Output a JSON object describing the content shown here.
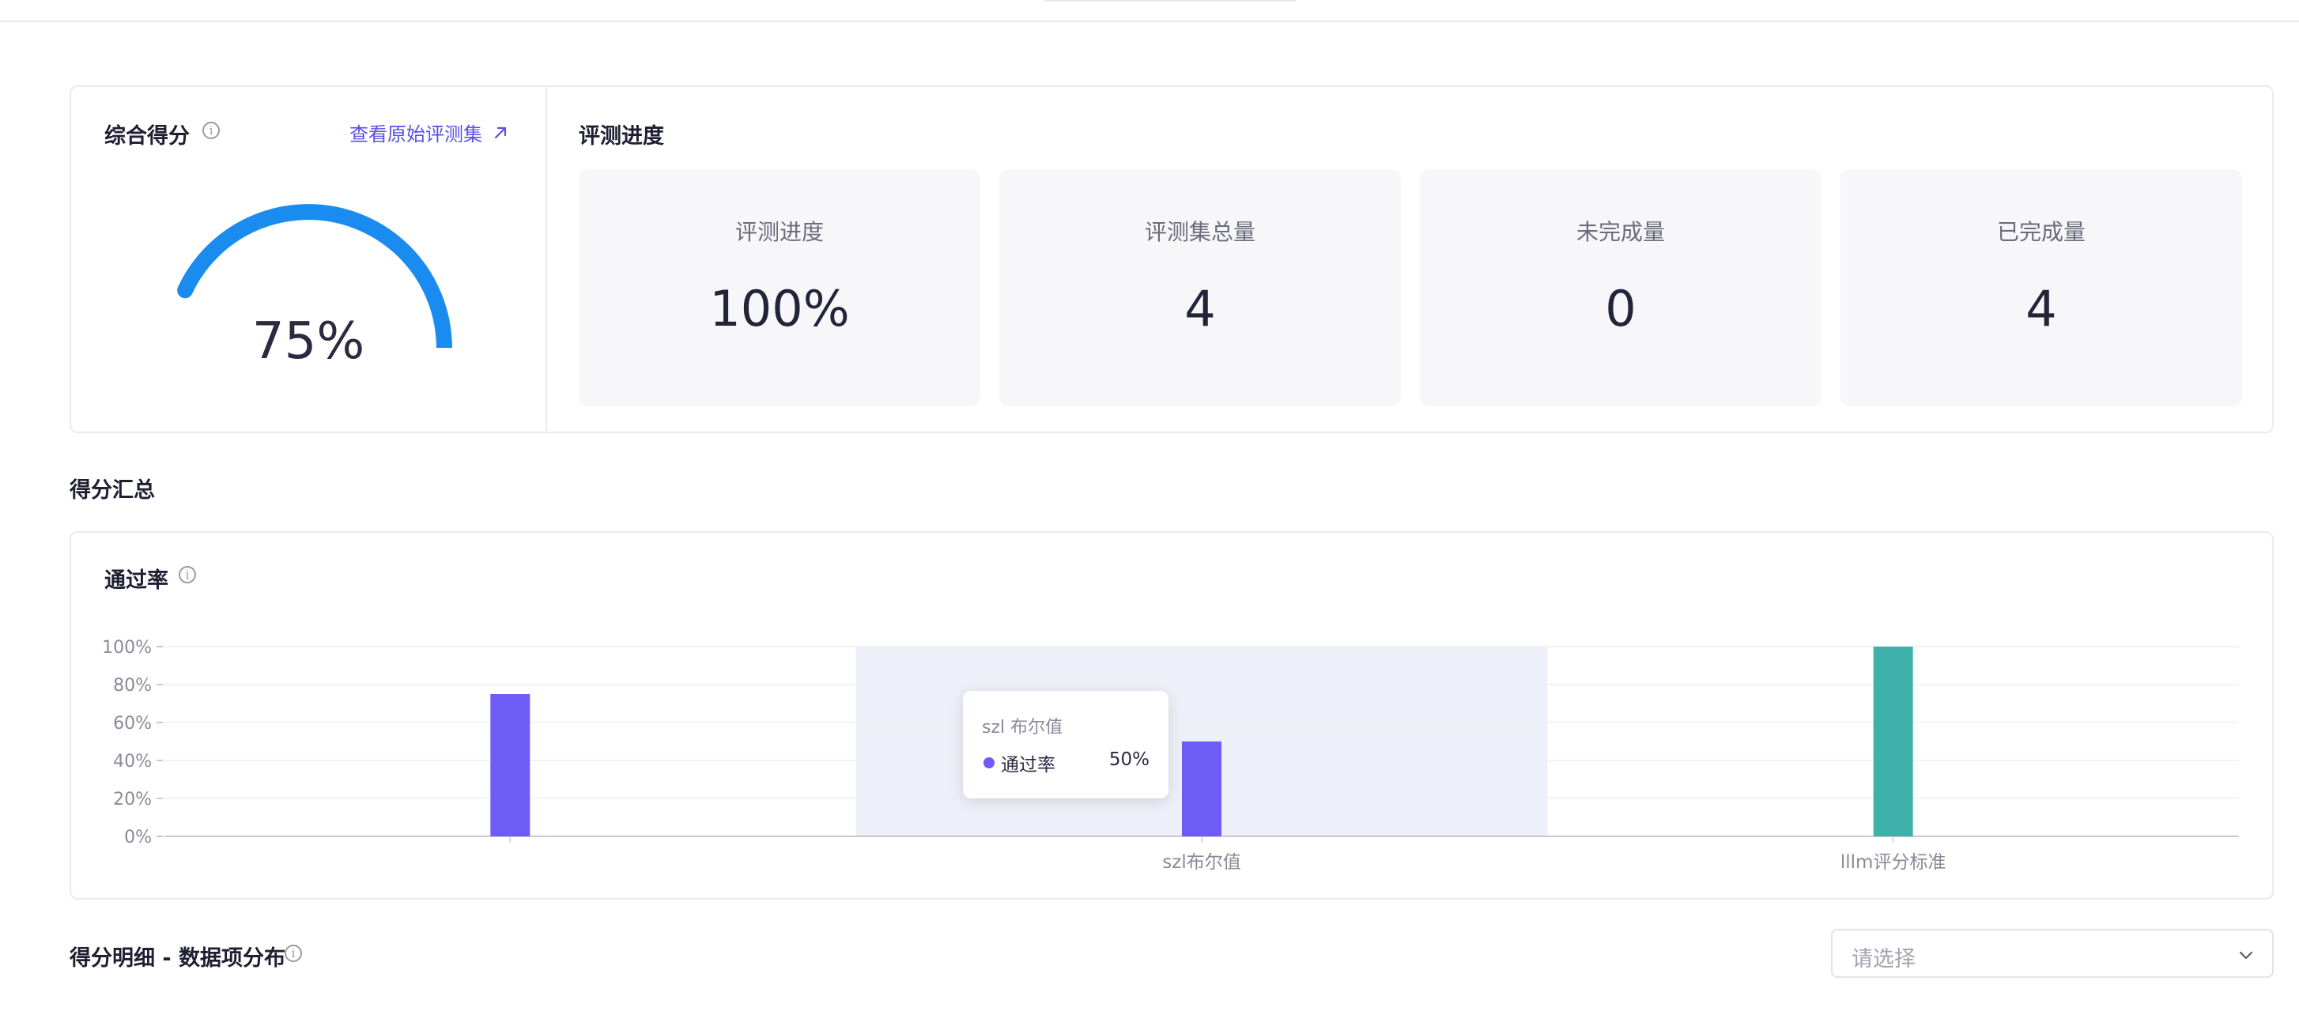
{
  "score_card": {
    "title": "综合得分",
    "info_icon": "info-icon",
    "link_label": "查看原始评测集",
    "link_icon": "arrow-up-right-icon",
    "gauge_value": "75%",
    "gauge_fraction": 0.75,
    "gauge_color": "#1a8cf0"
  },
  "progress": {
    "title": "评测进度",
    "stats": [
      {
        "label": "评测进度",
        "value": "100%"
      },
      {
        "label": "评测集总量",
        "value": "4"
      },
      {
        "label": "未完成量",
        "value": "0"
      },
      {
        "label": "已完成量",
        "value": "4"
      }
    ]
  },
  "summary_section": {
    "title": "得分汇总"
  },
  "pass_rate_card": {
    "title": "通过率",
    "tooltip": {
      "title": "szl 布尔值",
      "series_name": "通过率",
      "value": "50%"
    }
  },
  "chart_data": {
    "type": "bar",
    "title": "通过率",
    "categories": [
      "",
      "szl布尔值",
      "lllm评分标准"
    ],
    "series": [
      {
        "name": "通过率",
        "values": [
          75,
          50,
          100
        ]
      }
    ],
    "bar_colors": [
      "#6f5cf6",
      "#6f5cf6",
      "#3fb1ab"
    ],
    "ylim": [
      0,
      100
    ],
    "yticks": [
      "0%",
      "20%",
      "40%",
      "60%",
      "80%",
      "100%"
    ],
    "grid": true,
    "highlighted_category": "szl布尔值"
  },
  "detail_section": {
    "title": "得分明细 - 数据项分布",
    "info_icon": "info-icon"
  },
  "select": {
    "placeholder": "请选择",
    "icon": "chevron-down-icon"
  }
}
